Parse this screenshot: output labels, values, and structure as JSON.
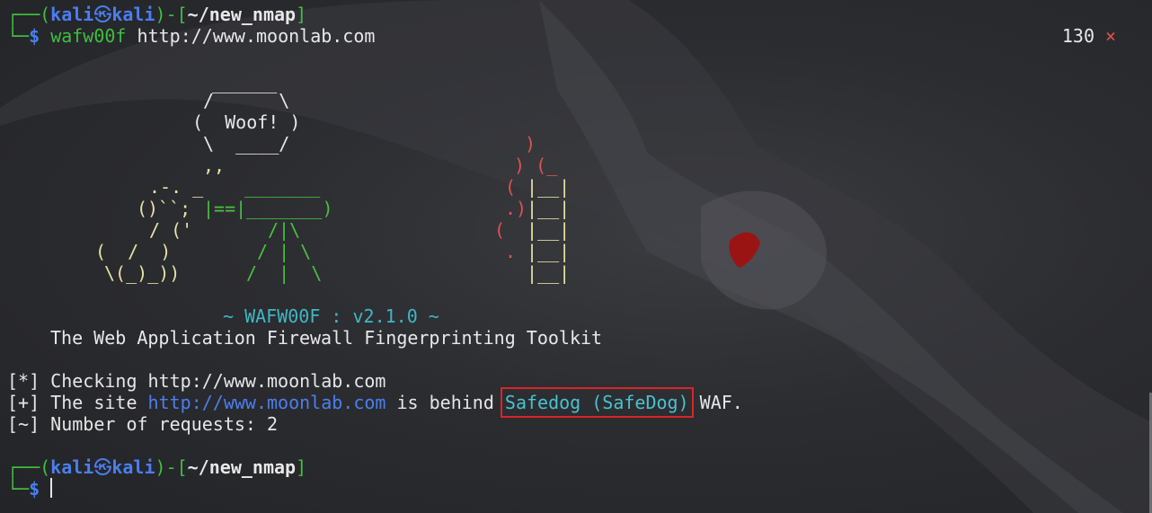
{
  "prompt1": {
    "corner_top": "┌──",
    "paren_open": "(",
    "user": "kali",
    "at": "㉿",
    "host": "kali",
    "paren_close": ")",
    "dash": "-",
    "bracket_open": "[",
    "path": "~/new_nmap",
    "bracket_close": "]",
    "corner_bottom": "└─",
    "dollar": "$",
    "command": "wafw00f",
    "argument": "http://www.moonlab.com"
  },
  "status": {
    "exit_code": "130",
    "error_icon": "×"
  },
  "banner": {
    "ascii_lines": [
      "                  ______",
      "                 /      \\",
      "                (  Woof! )",
      "                 \\  ____/",
      "                 ,,",
      "             .-. _",
      "            ()``; |==|_______)",
      "            / ('        /|\\",
      "           (  /  )     / | \\",
      "            \\(_)_))   /  |  \\"
    ],
    "bubble_top": "______",
    "bubble_side1": "/      \\",
    "bubble_text": "(  Woof! )",
    "bubble_bottom": "\\  ____/",
    "dog_1": ",,",
    "dog_2": ".-. _",
    "dog_3": "()``;",
    "cannon_top": "_______",
    "cannon": "|==|_______)",
    "dog_4": "/ ('",
    "stand_1": "/|\\",
    "dog_5": "(  /  )",
    "stand_2": "/ | \\",
    "dog_6": "\\(_)_))",
    "stand_3": "/  |  \\",
    "fire_1": ")",
    "fire_2": ") (_",
    "fire_3": "(",
    "fire_4": ".)",
    "fire_5": "(",
    "fire_6": ".",
    "wall_1": "|__|",
    "title": "~ WAFW00F : v2.1.0 ~",
    "subtitle": "The Web Application Firewall Fingerprinting Toolkit"
  },
  "output": {
    "check_prefix": "[*]",
    "check_text": "Checking http://www.moonlab.com",
    "found_prefix": "[+]",
    "found_text1": "The site",
    "found_url": "http://www.moonlab.com",
    "found_text2": "is behind",
    "waf_name": "Safedog (SafeDog)",
    "found_text3": "WAF.",
    "req_prefix": "[~]",
    "req_text": "Number of requests: 2"
  },
  "prompt2": {
    "corner_top": "┌──",
    "paren_open": "(",
    "user": "kali",
    "at": "㉿",
    "host": "kali",
    "paren_close": ")",
    "dash": "-",
    "bracket_open": "[",
    "path": "~/new_nmap",
    "bracket_close": "]",
    "corner_bottom": "└─",
    "dollar": "$"
  },
  "colors": {
    "background": "#2c2d31",
    "prompt_green": "#3fbf3f",
    "prompt_blue": "#4a7ff0",
    "fire_red": "#e0524f",
    "ascii_yellow": "#e8e2a6",
    "waf_cyan": "#49c2d0",
    "highlight_box": "#d6262a"
  }
}
